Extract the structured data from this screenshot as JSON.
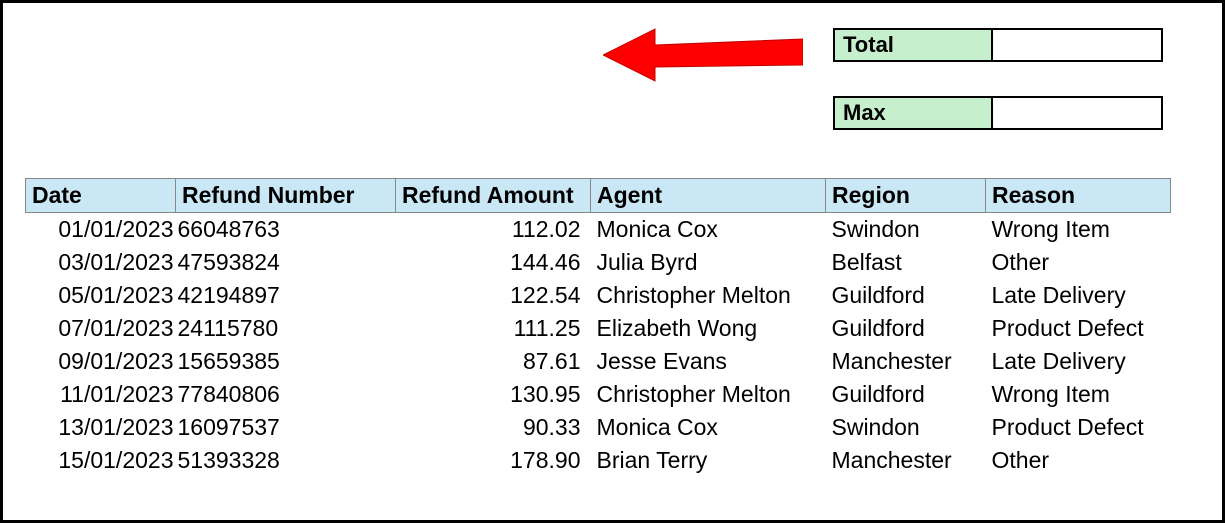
{
  "summary": {
    "total_label": "Total",
    "total_value": "",
    "max_label": "Max",
    "max_value": ""
  },
  "table": {
    "headers": {
      "date": "Date",
      "refund_number": "Refund Number",
      "refund_amount": "Refund Amount",
      "agent": "Agent",
      "region": "Region",
      "reason": "Reason"
    },
    "rows": [
      {
        "date": "01/01/2023",
        "refund_number": "66048763",
        "refund_amount": "112.02",
        "agent": "Monica Cox",
        "region": "Swindon",
        "reason": "Wrong Item"
      },
      {
        "date": "03/01/2023",
        "refund_number": "47593824",
        "refund_amount": "144.46",
        "agent": "Julia Byrd",
        "region": "Belfast",
        "reason": "Other"
      },
      {
        "date": "05/01/2023",
        "refund_number": "42194897",
        "refund_amount": "122.54",
        "agent": "Christopher Melton",
        "region": "Guildford",
        "reason": "Late Delivery"
      },
      {
        "date": "07/01/2023",
        "refund_number": "24115780",
        "refund_amount": "111.25",
        "agent": "Elizabeth Wong",
        "region": "Guildford",
        "reason": "Product Defect"
      },
      {
        "date": "09/01/2023",
        "refund_number": "15659385",
        "refund_amount": "87.61",
        "agent": "Jesse Evans",
        "region": "Manchester",
        "reason": "Late Delivery"
      },
      {
        "date": "11/01/2023",
        "refund_number": "77840806",
        "refund_amount": "130.95",
        "agent": "Christopher Melton",
        "region": "Guildford",
        "reason": "Wrong Item"
      },
      {
        "date": "13/01/2023",
        "refund_number": "16097537",
        "refund_amount": "90.33",
        "agent": "Monica Cox",
        "region": "Swindon",
        "reason": "Product Defect"
      },
      {
        "date": "15/01/2023",
        "refund_number": "51393328",
        "refund_amount": "178.90",
        "agent": "Brian Terry",
        "region": "Manchester",
        "reason": "Other"
      }
    ]
  }
}
